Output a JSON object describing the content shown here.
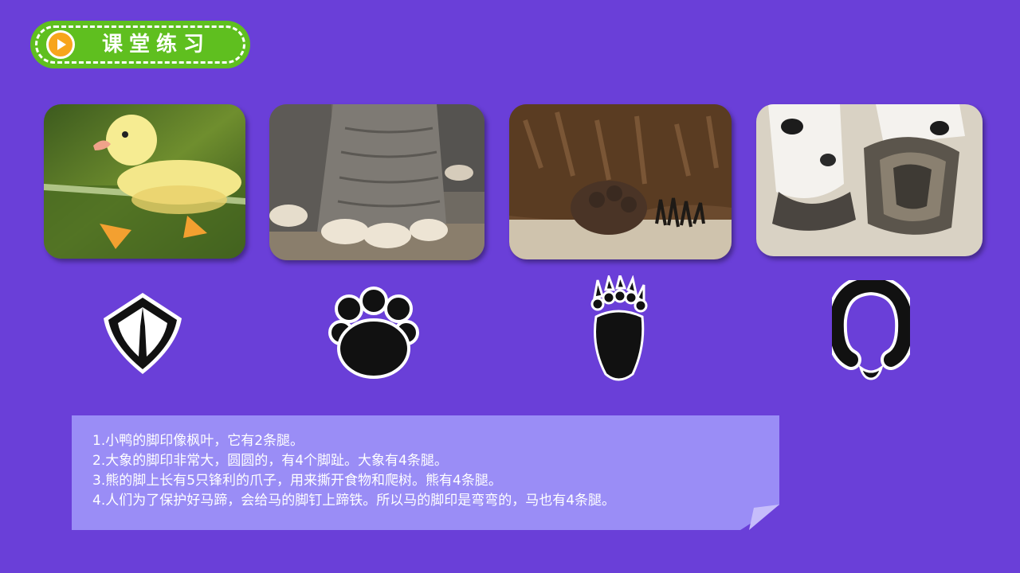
{
  "header": {
    "title": "课堂练习",
    "icon": "play-icon",
    "badge_color": "#5fbf1f",
    "icon_color": "#f7a51c"
  },
  "photos": [
    {
      "subject": "duckling",
      "icon": "duck-photo"
    },
    {
      "subject": "elephant-feet",
      "icon": "elephant-feet-photo"
    },
    {
      "subject": "bear-paw",
      "icon": "bear-paw-photo"
    },
    {
      "subject": "horse-hooves",
      "icon": "horse-hoof-photo"
    }
  ],
  "footprints": [
    {
      "icon": "duck-footprint-icon"
    },
    {
      "icon": "elephant-footprint-icon"
    },
    {
      "icon": "bear-footprint-icon"
    },
    {
      "icon": "horseshoe-footprint-icon"
    }
  ],
  "notes": [
    "1.小鸭的脚印像枫叶，它有2条腿。",
    "2.大象的脚印非常大，圆圆的，有4个脚趾。大象有4条腿。",
    "3.熊的脚上长有5只锋利的爪子，用来撕开食物和爬树。熊有4条腿。",
    "4.人们为了保护好马蹄，会给马的脚钉上蹄铁。所以马的脚印是弯弯的，马也有4条腿。"
  ],
  "colors": {
    "background": "#6a3fd8",
    "note_box": "#9a8df6",
    "note_fold": "#c6bdfb"
  }
}
